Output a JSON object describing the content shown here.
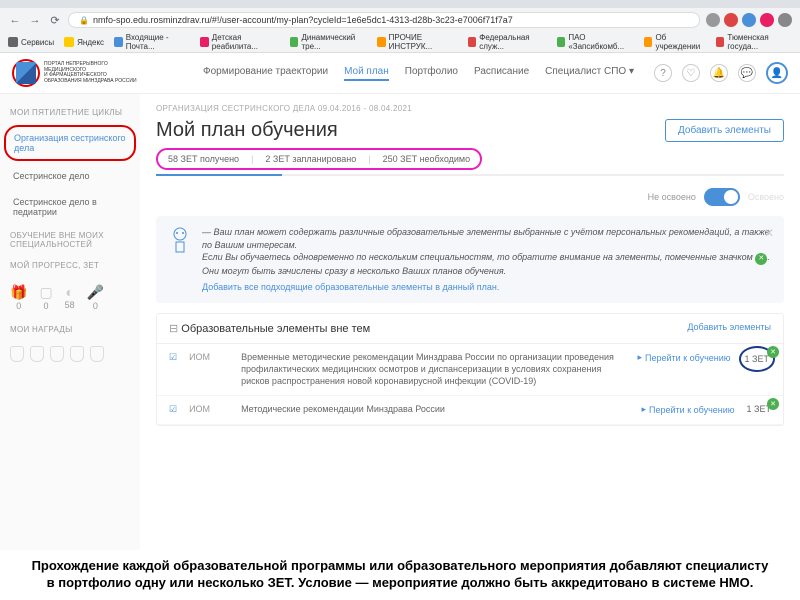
{
  "browser": {
    "url": "nmfo-spo.edu.rosminzdrav.ru/#!/user-account/my-plan?cycleId=1e6e5dc1-4313-d28b-3c23-e7006f71f7a7",
    "bookmarks": [
      "Сервисы",
      "Яндекс",
      "Входящие - Почта...",
      "Детская реабилита...",
      "Динамический тре...",
      "ПРОЧИЕ ИНСТРУК...",
      "Федеральная служ...",
      "ПАО «Запсибкомб...",
      "Об учреждении",
      "Тюменская госуда..."
    ]
  },
  "logo_text": "ПОРТАЛ НЕПРЕРЫВНОГО\nМЕДИЦИНСКОГО\nИ ФАРМАЦЕВТИЧЕСКОГО\nОБРАЗОВАНИЯ МИНЗДРАВА РОССИИ",
  "top_nav": [
    "Формирование траектории",
    "Мой план",
    "Портфолио",
    "Расписание",
    "Специалист СПО"
  ],
  "sidebar": {
    "h1": "МОИ ПЯТИЛЕТНИЕ ЦИКЛЫ",
    "items1": [
      "Организация сестринского дела",
      "Сестринское дело",
      "Сестринское дело в педиатрии"
    ],
    "h2": "ОБУЧЕНИЕ ВНЕ МОИХ СПЕЦИАЛЬНОСТЕЙ",
    "h3": "МОЙ ПРОГРЕСС, ЗЕТ",
    "prog": [
      "0",
      "0",
      "58",
      "0"
    ],
    "h4": "МОИ НАГРАДЫ"
  },
  "content": {
    "breadcrumb": "ОРГАНИЗАЦИЯ СЕСТРИНСКОГО ДЕЛА 09.04.2016 - 08.04.2021",
    "title": "Мой план обучения",
    "add_btn": "Добавить элементы",
    "zet": [
      "58 ЗЕТ получено",
      "2 ЗЕТ запланировано",
      "250 ЗЕТ необходимо"
    ],
    "toggle_left": "Не освоено",
    "toggle_right": "Освоено",
    "info": {
      "l1": "— Ваш план может содержать различные образовательные элементы выбранные с учётом персональных рекомендаций, а также по Вашим интересам.",
      "l2": "Если Вы обучаетесь одновременно по нескольким специальностям, то обратите внимание на элементы, помеченные значком",
      "l3": ". Они могут быть зачислены сразу в несколько Ваших планов обучения.",
      "link": "Добавить все подходящие образовательные элементы в данный план."
    },
    "elements": {
      "header": "Образовательные элементы вне тем",
      "add": "Добавить элементы",
      "rows": [
        {
          "type": "ИОМ",
          "desc": "Временные методические рекомендации Минздрава России по организации проведения профилактических медицинских осмотров и диспансеризации в условиях сохранения рисков распространения новой коронавирусной инфекции (COVID-19)",
          "link": "Перейти к обучению",
          "zet": "1 ЗЕТ"
        },
        {
          "type": "ИОМ",
          "desc": "Методические рекомендации Минздрава России",
          "link": "Перейти к обучению",
          "zet": "1 ЗЕТ"
        }
      ]
    }
  },
  "caption": "Прохождение каждой образовательной программы или образовательного мероприятия добавляют специалисту в портфолио одну или несколько ЗЕТ. Условие — мероприятие должно быть аккредитовано в системе НМО."
}
